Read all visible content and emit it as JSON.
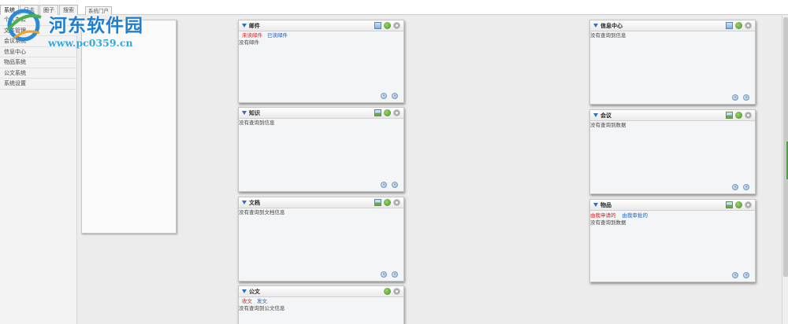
{
  "left_tabs": [
    "系统",
    "日志",
    "圈子",
    "搜索"
  ],
  "nav_items": [
    "个人办公",
    "文件管理",
    "会议系统",
    "信息中心",
    "物品系统",
    "公文系统",
    "系统设置"
  ],
  "portal_button": "系统门户",
  "watermark": {
    "title": "河东软件园",
    "url": "www.pc0359.cn"
  },
  "portlets": {
    "mail": {
      "title": "邮件",
      "links": [
        "未读邮件",
        "已读邮件"
      ],
      "empty": "没有邮件"
    },
    "knowledge": {
      "title": "知识",
      "empty": "没有查询到信息"
    },
    "docs": {
      "title": "文档",
      "empty": "没有查询到文档信息"
    },
    "official": {
      "title": "公文",
      "links": [
        "收文",
        "发文"
      ],
      "empty": "没有查询到公文信息"
    },
    "info": {
      "title": "信息中心",
      "empty": "没有查询到信息"
    },
    "meeting": {
      "title": "会议",
      "empty": "没有查询到数据"
    },
    "goods": {
      "title": "物品",
      "links": [
        "由我申请的",
        "由我审批的"
      ],
      "empty": "没有查询到数据"
    }
  },
  "colors": {
    "accent": "#2d6fc8",
    "link_red": "#d42020",
    "link_blue": "#1a60c0",
    "watermark": "#1e7fd0"
  }
}
